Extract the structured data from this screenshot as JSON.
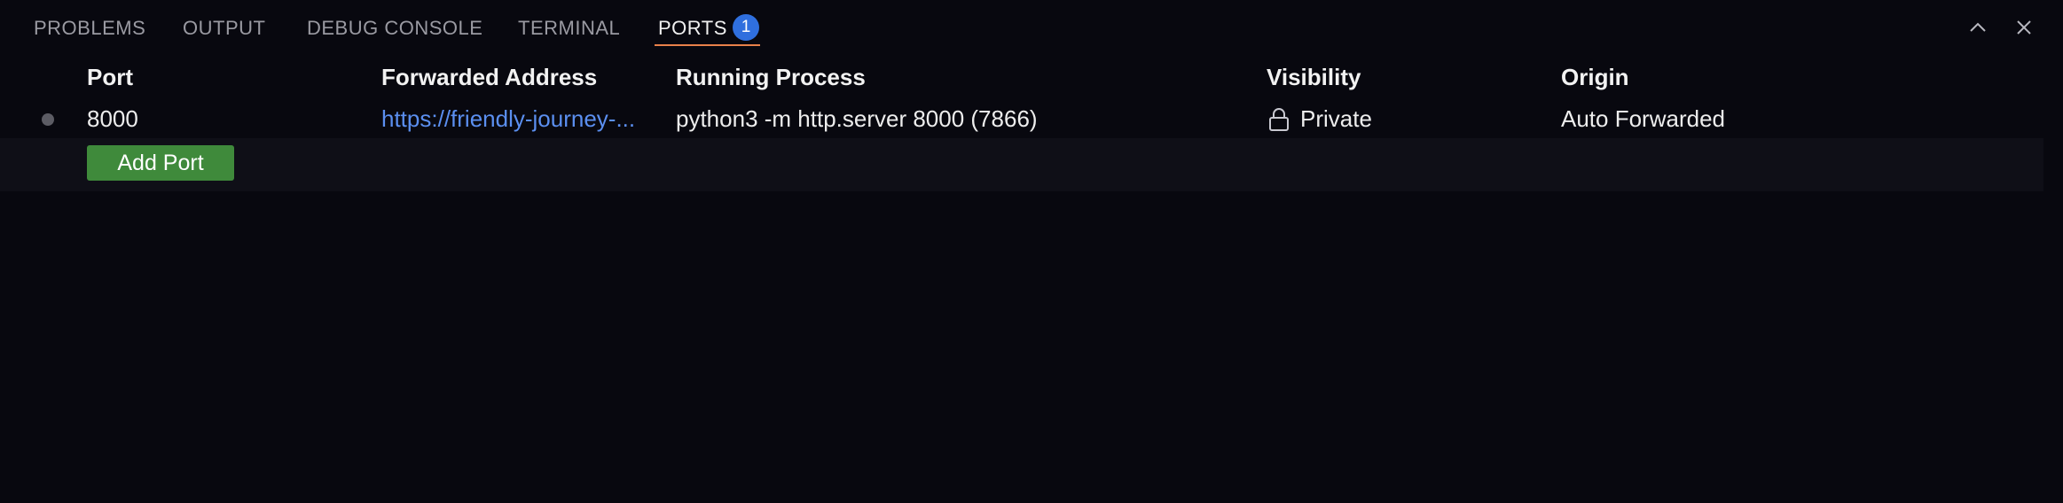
{
  "tabs": [
    {
      "label": "PROBLEMS"
    },
    {
      "label": "OUTPUT"
    },
    {
      "label": "DEBUG CONSOLE"
    },
    {
      "label": "TERMINAL"
    },
    {
      "label": "PORTS",
      "badge": "1",
      "active": true
    }
  ],
  "window_controls": {
    "maximize_icon": "chevron-up-icon",
    "close_icon": "close-icon"
  },
  "table": {
    "headers": {
      "port": "Port",
      "forwarded_address": "Forwarded Address",
      "running_process": "Running Process",
      "visibility": "Visibility",
      "origin": "Origin"
    },
    "rows": [
      {
        "port": "8000",
        "forwarded_address": "https://friendly-journey-...",
        "running_process": "python3 -m http.server 8000 (7866)",
        "visibility": "Private",
        "visibility_icon": "lock-icon",
        "origin": "Auto Forwarded"
      }
    ],
    "add_button_label": "Add Port"
  },
  "colors": {
    "background": "#08080f",
    "active_tab_underline": "#e8814a",
    "badge": "#2f6fde",
    "link": "#5b8ff0",
    "add_button": "#3f8a3b"
  }
}
